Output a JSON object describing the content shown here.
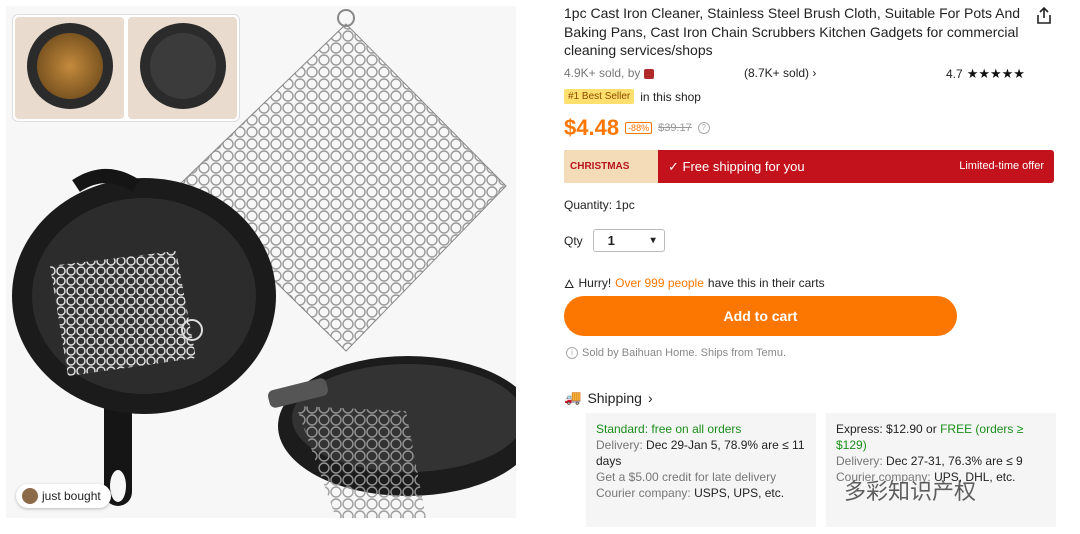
{
  "gallery": {
    "just_bought": "just bought"
  },
  "product": {
    "title": "1pc Cast Iron Cleaner, Stainless Steel Brush Cloth, Suitable For Pots And Baking Pans, Cast Iron Chain Scrubbers Kitchen Gadgets for commercial cleaning services/shops",
    "sold_by_text": "4.9K+ sold, by",
    "store_sold": "(8.7K+ sold)",
    "rating": "4.7",
    "rating_stars": 4.7,
    "best_seller_badge": "#1 Best Seller",
    "best_seller_text": "in this shop",
    "price": "$4.48",
    "discount": "-88%",
    "original_price": "$39.17"
  },
  "banner": {
    "tag": "CHRISTMAS",
    "free_shipping": "Free shipping for you",
    "limited": "Limited-time offer",
    "color": "#c3121b"
  },
  "quantity": {
    "label": "Quantity: 1pc",
    "qty_label": "Qty",
    "qty_value": "1"
  },
  "hurry": {
    "prefix": "Hurry!",
    "highlight": "Over 999 people",
    "suffix": "have this in their carts"
  },
  "cart": {
    "button_label": "Add to cart",
    "color": "#fb7701"
  },
  "seller_note": "Sold by Baihuan Home. Ships from Temu.",
  "shipping": {
    "heading": "Shipping",
    "standard": {
      "title": "Standard: free on all orders",
      "delivery_label": "Delivery:",
      "delivery_value": "Dec 29-Jan 5, 78.9% are ≤ 11 days",
      "credit": "Get a $5.00 credit for late delivery",
      "courier_label": "Courier company:",
      "courier_value": "USPS, UPS, etc."
    },
    "express": {
      "title_prefix": "Express: $12.90 or",
      "title_free": "FREE (orders ≥ $129)",
      "delivery_label": "Delivery:",
      "delivery_value": "Dec 27-31, 76.3% are ≤ 9",
      "courier_label": "Courier company:",
      "courier_value": "UPS, DHL, etc."
    }
  },
  "watermark": "多彩知识产权"
}
